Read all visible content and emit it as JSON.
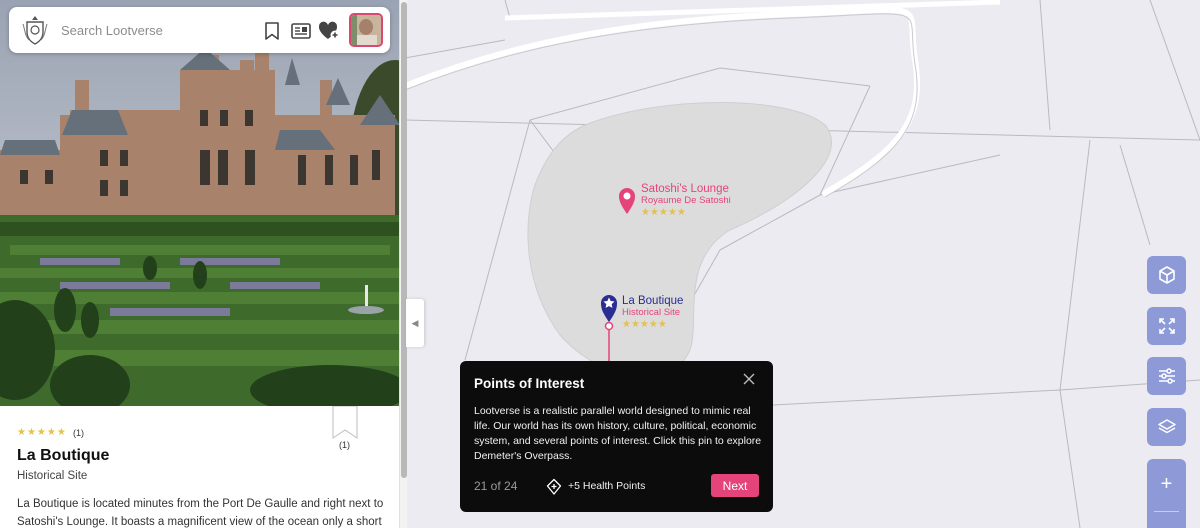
{
  "search": {
    "placeholder": "Search Lootverse"
  },
  "icons": {
    "logo": "crest-logo-icon",
    "bookmark": "bookmark-icon",
    "news": "newspaper-icon",
    "favorites": "heart-plus-icon",
    "avatar": "user-avatar"
  },
  "map": {
    "pois": [
      {
        "name": "Satoshi's Lounge",
        "subtitle": "Royaume De Satoshi",
        "stars": "★★★★★",
        "color": "#e5447a"
      },
      {
        "name": "La Boutique",
        "subtitle": "Historical Site",
        "stars": "★★★★★",
        "color": "#2a2d91"
      }
    ]
  },
  "place": {
    "rating_stars": "★★★★★",
    "rating_count": "(1)",
    "title": "La Boutique",
    "type": "Historical Site",
    "desc_part1": "La Boutique is located minutes from the Port De Gaulle and right next to Satoshi's ",
    "desc_link": "Lounge. It boasts a magnificent view",
    "desc_part2": " of the ocean only a short",
    "bookmark_count": "(1)"
  },
  "tooltip": {
    "title": "Points of Interest",
    "body": "Lootverse is a realistic parallel world designed to mimic real life. Our world has its own history, culture, political, economic system, and several points of interest. Click this pin to explore Demeter's Overpass.",
    "page": "21 of 24",
    "health": "+5 Health Points",
    "next_label": "Next"
  },
  "controls": {
    "zoom_in": "+"
  },
  "colors": {
    "accent_pink": "#e5447a",
    "pin_navy": "#2a2d91",
    "control_blue": "#8e9ad8",
    "map_bg": "#ecebf1",
    "area_fill": "#dcdcdc",
    "star_gold": "#e6c04a"
  }
}
